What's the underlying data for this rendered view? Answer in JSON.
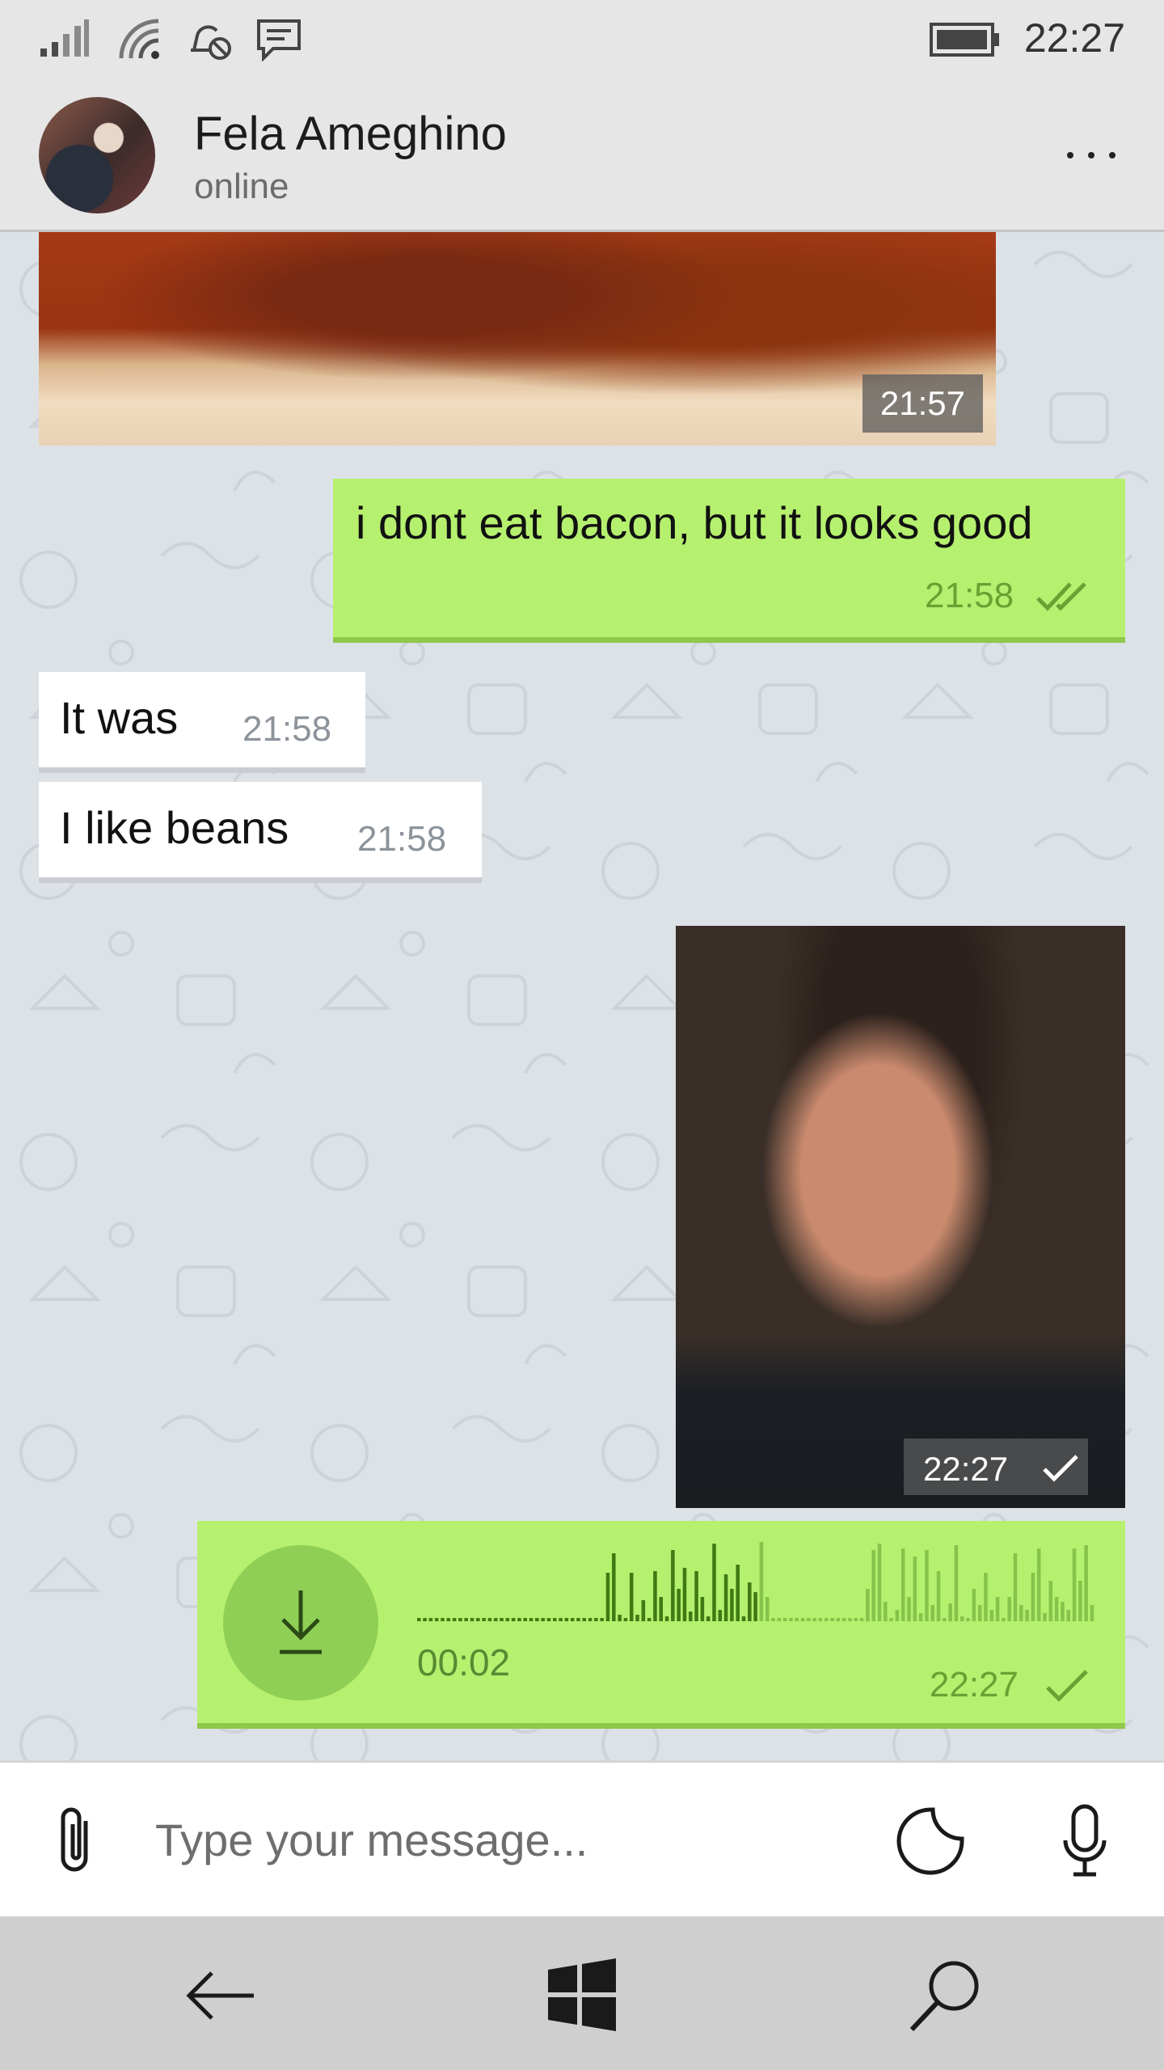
{
  "status_bar": {
    "time": "22:27",
    "icons": [
      "signal-icon",
      "wifi-icon",
      "do-not-disturb-icon",
      "message-icon",
      "battery-icon"
    ]
  },
  "header": {
    "contact_name": "Fela Ameghino",
    "contact_status": "online",
    "more_label": "more-options"
  },
  "messages": [
    {
      "type": "photo",
      "direction": "in",
      "time": "21:57"
    },
    {
      "type": "text",
      "direction": "out",
      "text": "i dont eat bacon, but it looks good",
      "time": "21:58",
      "status": "read"
    },
    {
      "type": "text",
      "direction": "in",
      "text": "It was",
      "time": "21:58"
    },
    {
      "type": "text",
      "direction": "in",
      "text": "I like beans",
      "time": "21:58"
    },
    {
      "type": "photo",
      "direction": "out",
      "time": "22:27",
      "status": "sent"
    },
    {
      "type": "voice",
      "direction": "out",
      "duration": "00:02",
      "time": "22:27",
      "status": "sent",
      "played_fraction": 0.5
    }
  ],
  "composer": {
    "placeholder": "Type your message..."
  },
  "colors": {
    "outgoing_bubble": "#b6f06f",
    "incoming_bubble": "#ffffff",
    "chat_background": "#dde2e7"
  }
}
